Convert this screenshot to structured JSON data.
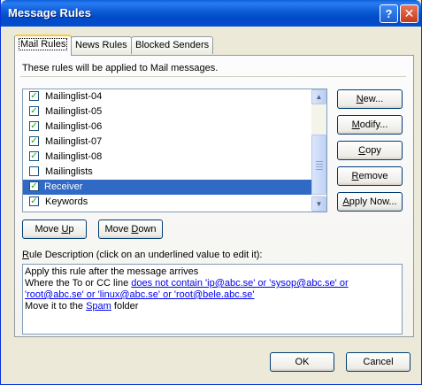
{
  "window": {
    "title": "Message Rules",
    "help_glyph": "?",
    "close_glyph": "✕"
  },
  "tabs": [
    {
      "label": "Mail Rules",
      "active": true
    },
    {
      "label": "News Rules",
      "active": false
    },
    {
      "label": "Blocked Senders",
      "active": false
    }
  ],
  "panel": {
    "header": "These rules will be applied to Mail messages."
  },
  "rules": [
    {
      "label": "Mailinglist-04",
      "checked": true,
      "selected": false
    },
    {
      "label": "Mailinglist-05",
      "checked": true,
      "selected": false
    },
    {
      "label": "Mailinglist-06",
      "checked": true,
      "selected": false
    },
    {
      "label": "Mailinglist-07",
      "checked": true,
      "selected": false
    },
    {
      "label": "Mailinglist-08",
      "checked": true,
      "selected": false
    },
    {
      "label": "Mailinglists",
      "checked": false,
      "selected": false
    },
    {
      "label": "Receiver",
      "checked": true,
      "selected": true
    },
    {
      "label": "Keywords",
      "checked": true,
      "selected": false
    }
  ],
  "side_buttons": {
    "new": {
      "pre": "",
      "ul": "N",
      "post": "ew..."
    },
    "modify": {
      "pre": "",
      "ul": "M",
      "post": "odify..."
    },
    "copy": {
      "pre": "",
      "ul": "C",
      "post": "opy"
    },
    "remove": {
      "pre": "",
      "ul": "R",
      "post": "emove"
    },
    "apply_now": {
      "pre": "",
      "ul": "A",
      "post": "pply Now..."
    }
  },
  "move_buttons": {
    "up": {
      "pre": "Move ",
      "ul": "U",
      "post": "p"
    },
    "down": {
      "pre": "Move ",
      "ul": "D",
      "post": "own"
    }
  },
  "description": {
    "label_ul": "R",
    "label_rest": "ule Description (click on an underlined value to edit it):",
    "line1": "Apply this rule after the message arrives",
    "line2_pre": "Where the To or CC line ",
    "line2_link": "does not contain 'ip@abc.se' or 'sysop@abc.se' or",
    "line3_link": "'root@abc.se' or 'linux@abc.se' or 'root@bele.abc.se'",
    "line4_pre": "Move it to the ",
    "line4_link": "Spam",
    "line4_post": " folder"
  },
  "footer": {
    "ok": "OK",
    "cancel": "Cancel"
  },
  "colors": {
    "title_bar": "#0a5ad4",
    "selection": "#316ac5",
    "dialog_bg": "#ece9d8"
  }
}
